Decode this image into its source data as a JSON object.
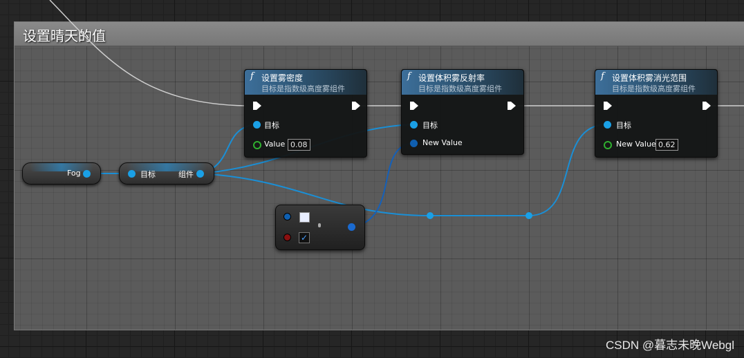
{
  "comment": {
    "title": "设置晴天的值"
  },
  "nodes": {
    "fog_var": {
      "pin_label": "Fog"
    },
    "get_component": {
      "input_label": "目标",
      "output_label": "组件"
    },
    "set_fog_density": {
      "title": "设置雾密度",
      "subtitle": "目标是指数级高度雾组件",
      "target_label": "目标",
      "value_label": "Value",
      "value": "0.08"
    },
    "set_volumetric_albedo": {
      "title": "设置体积雾反射率",
      "subtitle": "目标是指数级高度雾组件",
      "target_label": "目标",
      "value_label": "New Value"
    },
    "set_volumetric_extinction": {
      "title": "设置体积雾消光范围",
      "subtitle": "目标是指数级高度雾组件",
      "target_label": "目标",
      "value_label": "New Value",
      "value": "0.62"
    },
    "make_color": {
      "checkbox_checked": true
    }
  },
  "watermark": "CSDN @暮志未晚Webgl",
  "colors": {
    "object_pin": "#1aa0e6",
    "float_pin": "#2fb02f",
    "exec_wire": "#dddddd",
    "object_wire": "#1a8fd6",
    "struct_pin": "#0f5fb0"
  }
}
